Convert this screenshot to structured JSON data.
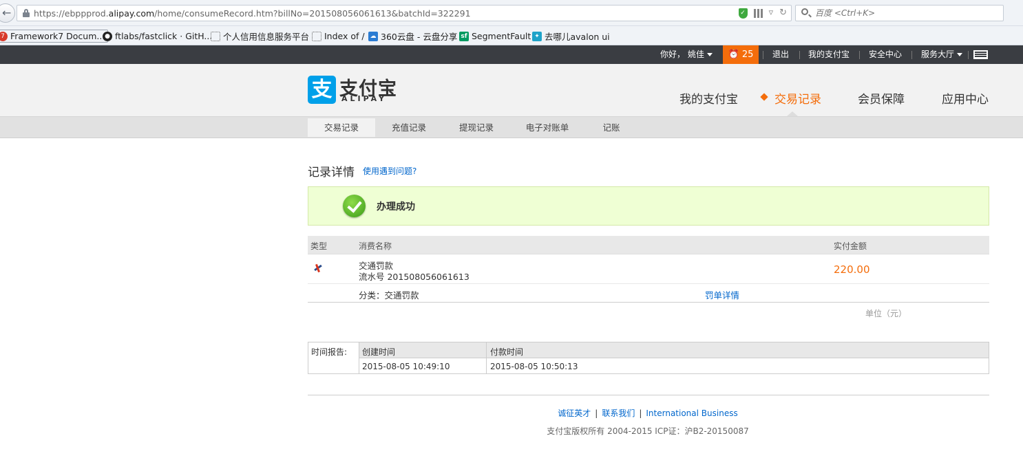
{
  "browser": {
    "url_prefix": "https://ebppprod.",
    "url_domain": "alipay.com",
    "url_suffix": "/home/consumeRecord.htm?billNo=201508056061613&batchId=322291",
    "search_placeholder": "百度 <Ctrl+K>",
    "bookmarks": [
      {
        "label": "Framework7 Docum...",
        "icon": "framework7-icon",
        "color": "#d83a2a"
      },
      {
        "label": "ftlabs/fastclick · GitH...",
        "icon": "github-icon",
        "color": "#222222"
      },
      {
        "label": "个人信用信息服务平台",
        "icon": "page-icon",
        "color": ""
      },
      {
        "label": "Index of /",
        "icon": "page-icon",
        "color": ""
      },
      {
        "label": "360云盘 - 云盘分享",
        "icon": "cloud-icon",
        "color": "#2b7cd3"
      },
      {
        "label": "SegmentFault",
        "icon": "segmentfault-icon",
        "color": "#009a61"
      },
      {
        "label": "去哪儿avalon ui",
        "icon": "qunar-icon",
        "color": "#1fa3c9"
      }
    ]
  },
  "topbar": {
    "greeting": "你好，",
    "user": "姚佳",
    "alarm_count": "25",
    "logout": "退出",
    "my_alipay": "我的支付宝",
    "security": "安全中心",
    "service": "服务大厅"
  },
  "header": {
    "logo_mark": "支",
    "logo_cn": "支付宝",
    "logo_en": "ALIPAY",
    "nav": [
      "我的支付宝",
      "交易记录",
      "会员保障",
      "应用中心"
    ],
    "accent": "#f46d0b"
  },
  "subnav": [
    "交易记录",
    "充值记录",
    "提现记录",
    "电子对账单",
    "记账"
  ],
  "record": {
    "title": "记录详情",
    "help": "使用遇到问题?",
    "status": "办理成功",
    "columns": [
      "类型",
      "消费名称",
      "实付金额"
    ],
    "item_name": "交通罚款",
    "serial": "流水号 201508056061613",
    "amount": "220.00",
    "category": "分类：交通罚款",
    "detail_link": "罚单详情",
    "unit": "单位（元）"
  },
  "time_report": {
    "label": "时间报告:",
    "created_label": "创建时间",
    "paid_label": "付款时间",
    "created": "2015-08-05 10:49:10",
    "paid": "2015-08-05 10:50:13"
  },
  "footer": {
    "links": [
      "诚征英才",
      "联系我们",
      "International Business"
    ],
    "copyright": "支付宝版权所有 2004-2015 ICP证：沪B2-20150087"
  }
}
